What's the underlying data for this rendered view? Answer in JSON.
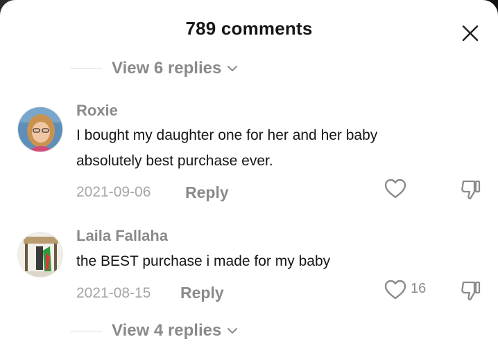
{
  "header": {
    "comment_count_label": "789 comments"
  },
  "threads": {
    "top_replies_label": "View 6 replies",
    "bottom_replies_label": "View 4 replies"
  },
  "comments": [
    {
      "username": "Roxie",
      "text_line1": "I bought my daughter one for her and her baby",
      "text_line2": "absolutely best purchase ever.",
      "date": "2021-09-06",
      "reply_label": "Reply",
      "like_count": ""
    },
    {
      "username": "Laila Fallaha",
      "text_line1": "the BEST purchase i made for my baby",
      "date": "2021-08-15",
      "reply_label": "Reply",
      "like_count": "16"
    }
  ],
  "icons": {
    "close": "close-icon",
    "chevron": "chevron-down-icon",
    "like": "heart-outline-icon",
    "dislike": "thumbs-down-icon"
  }
}
